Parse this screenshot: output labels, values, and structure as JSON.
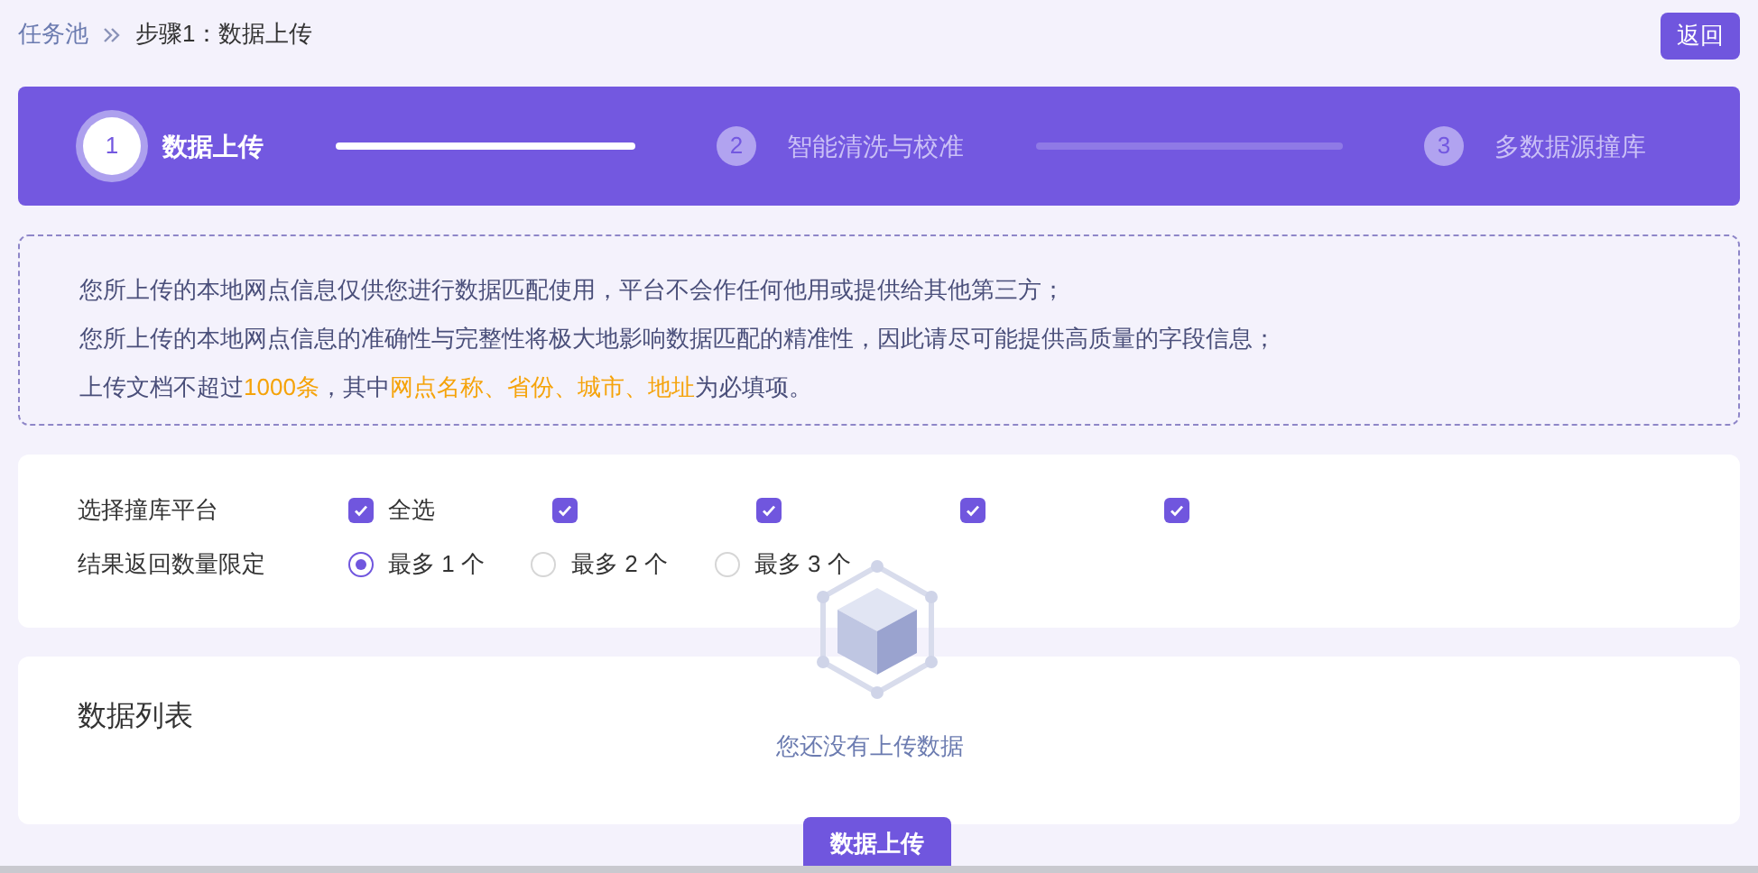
{
  "breadcrumb": [
    {
      "label": "任务池",
      "selected": false
    },
    {
      "label": "步骤1：数据上传",
      "selected": true
    }
  ],
  "back_button": "返回",
  "steps": [
    {
      "number": "1",
      "label": "数据上传",
      "selected": true
    },
    {
      "number": "2",
      "label": "智能清洗与校准",
      "selected": false
    },
    {
      "number": "3",
      "label": "多数据源撞库",
      "selected": false
    }
  ],
  "connectors": [
    {
      "selected": true
    },
    {
      "selected": false
    }
  ],
  "notice": [
    [
      {
        "text": "您所上传的本地网点信息仅供您进行数据匹配使用，平台不会作任何他用或提供给其他第三方；",
        "highlight": false
      }
    ],
    [
      {
        "text": "您所上传的本地网点信息的准确性与完整性将极大地影响数据匹配的精准性，因此请尽可能提供高质量的字段信息；",
        "highlight": false
      }
    ],
    [
      {
        "text": "上传文档不超过",
        "highlight": false
      },
      {
        "text": "1000条",
        "highlight": true
      },
      {
        "text": "，其中",
        "highlight": false
      },
      {
        "text": "网点名称、省份、城市、地址",
        "highlight": true
      },
      {
        "text": "为必填项。",
        "highlight": false
      }
    ]
  ],
  "platform": {
    "label": "选择撞库平台",
    "options": [
      {
        "label": "全选",
        "checked": true
      },
      {
        "checked": true
      },
      {
        "checked": true
      },
      {
        "checked": true
      },
      {
        "checked": true
      }
    ]
  },
  "limit": {
    "label": "结果返回数量限定",
    "options": [
      {
        "label": "最多 1 个",
        "selected": true
      },
      {
        "label": "最多 2 个",
        "selected": false
      },
      {
        "label": "最多 3 个",
        "selected": false
      }
    ]
  },
  "data_list": {
    "title": "数据列表",
    "empty_text": "您还没有上传数据"
  },
  "upload_button": "数据上传"
}
